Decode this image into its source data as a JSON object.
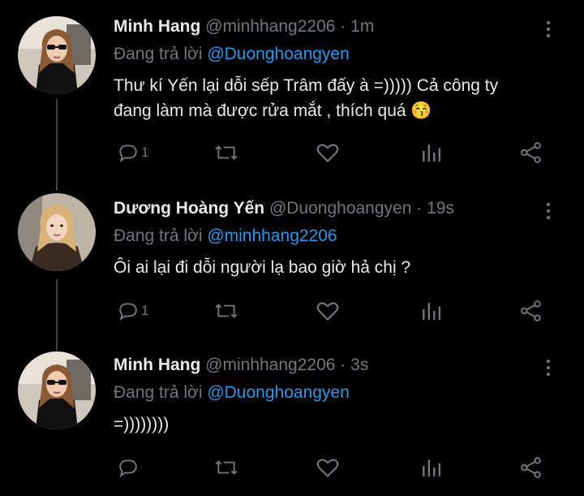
{
  "tweets": [
    {
      "name": "Minh Hang",
      "handle": "@minhhang2206",
      "dot": "·",
      "time": "1m",
      "reply_prefix": "Đang trả lời",
      "reply_to": "@Duonghoangyen",
      "text_line1": "Thư kí Yến lại dỗi sếp Trâm đấy à =))))) Cả công ty",
      "text_line2": "đang làm mà được rửa mắt , thích quá 😚",
      "reply_count": "1",
      "avatar": "woman-sunglasses-avatar"
    },
    {
      "name": "Dương Hoàng Yến",
      "handle": "@Duonghoangyen",
      "dot": "·",
      "time": "19s",
      "reply_prefix": "Đang trả lời",
      "reply_to": "@minhhang2206",
      "text_line1": "Ôi ai lại đi dỗi người lạ bao giờ hả chị ?",
      "reply_count": "1",
      "avatar": "woman-blonde-avatar"
    },
    {
      "name": "Minh Hang",
      "handle": "@minhhang2206",
      "dot": "·",
      "time": "3s",
      "reply_prefix": "Đang trả lời",
      "reply_to": "@Duonghoangyen",
      "text_line1": "=))))))))",
      "reply_count": "",
      "avatar": "woman-sunglasses-avatar"
    }
  ],
  "colors": {
    "background": "#000000",
    "text": "#e7e9ea",
    "secondary": "#71767b",
    "link": "#1d9bf0",
    "thread_line": "#3a3f44"
  },
  "icons": [
    "reply-icon",
    "retweet-icon",
    "like-icon",
    "analytics-icon",
    "share-icon",
    "more-icon"
  ]
}
